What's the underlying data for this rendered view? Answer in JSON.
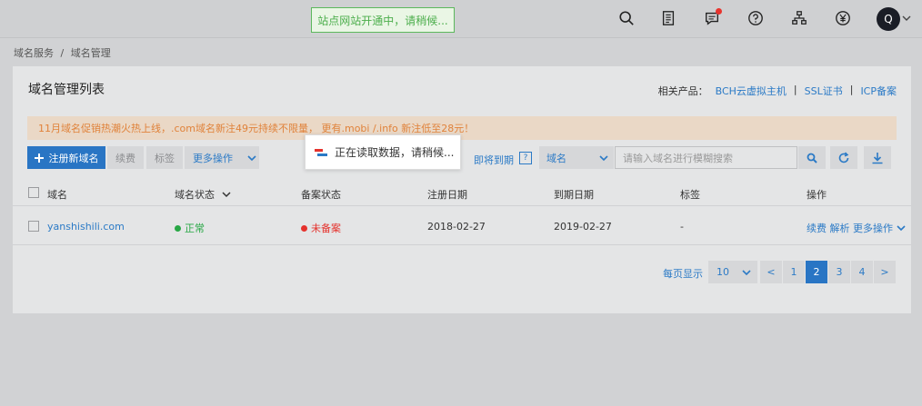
{
  "topbar": {
    "toast": "站点网站开通中，请稍候...",
    "avatar_letter": "Q",
    "icons": [
      "search-icon",
      "document-icon",
      "message-icon",
      "help-icon",
      "org-chart-icon",
      "yen-icon"
    ]
  },
  "breadcrumb": {
    "root": "域名服务",
    "sep": "/",
    "current": "域名管理"
  },
  "panel": {
    "title": "域名管理列表",
    "related_label": "相关产品：",
    "related_links": [
      "BCH云虚拟主机",
      "SSL证书",
      "ICP备案"
    ],
    "related_sep": "|"
  },
  "notice": "11月域名促销热潮火热上线，.com域名新注49元持续不限量， 更有.mobi /.info 新注低至28元！",
  "toolbar": {
    "register": "注册新域名",
    "renew": "续费",
    "tag": "标签",
    "more_ops": "更多操作",
    "expiring": "即将到期",
    "help_mark": "?",
    "select_value": "域名",
    "search_placeholder": "请输入域名进行模糊搜索"
  },
  "loading_text": "正在读取数据，请稍候...",
  "table": {
    "headers": [
      "域名",
      "域名状态",
      "备案状态",
      "注册日期",
      "到期日期",
      "标签",
      "操作"
    ],
    "rows": [
      {
        "domain": "yanshishili.com",
        "domain_status": "正常",
        "beian_status": "未备案",
        "reg_date": "2018-02-27",
        "exp_date": "2019-02-27",
        "tag": "-",
        "ops": [
          "续费",
          "解析",
          "更多操作"
        ]
      }
    ]
  },
  "pagination": {
    "per_page_label": "每页显示",
    "per_page_value": "10",
    "prev": "<",
    "next": ">",
    "pages": [
      "1",
      "2",
      "3",
      "4"
    ],
    "current": "2"
  },
  "colors": {
    "accent": "#2975c4",
    "success": "#28a745",
    "danger": "#e5322d",
    "notice_text": "#e0823a"
  }
}
